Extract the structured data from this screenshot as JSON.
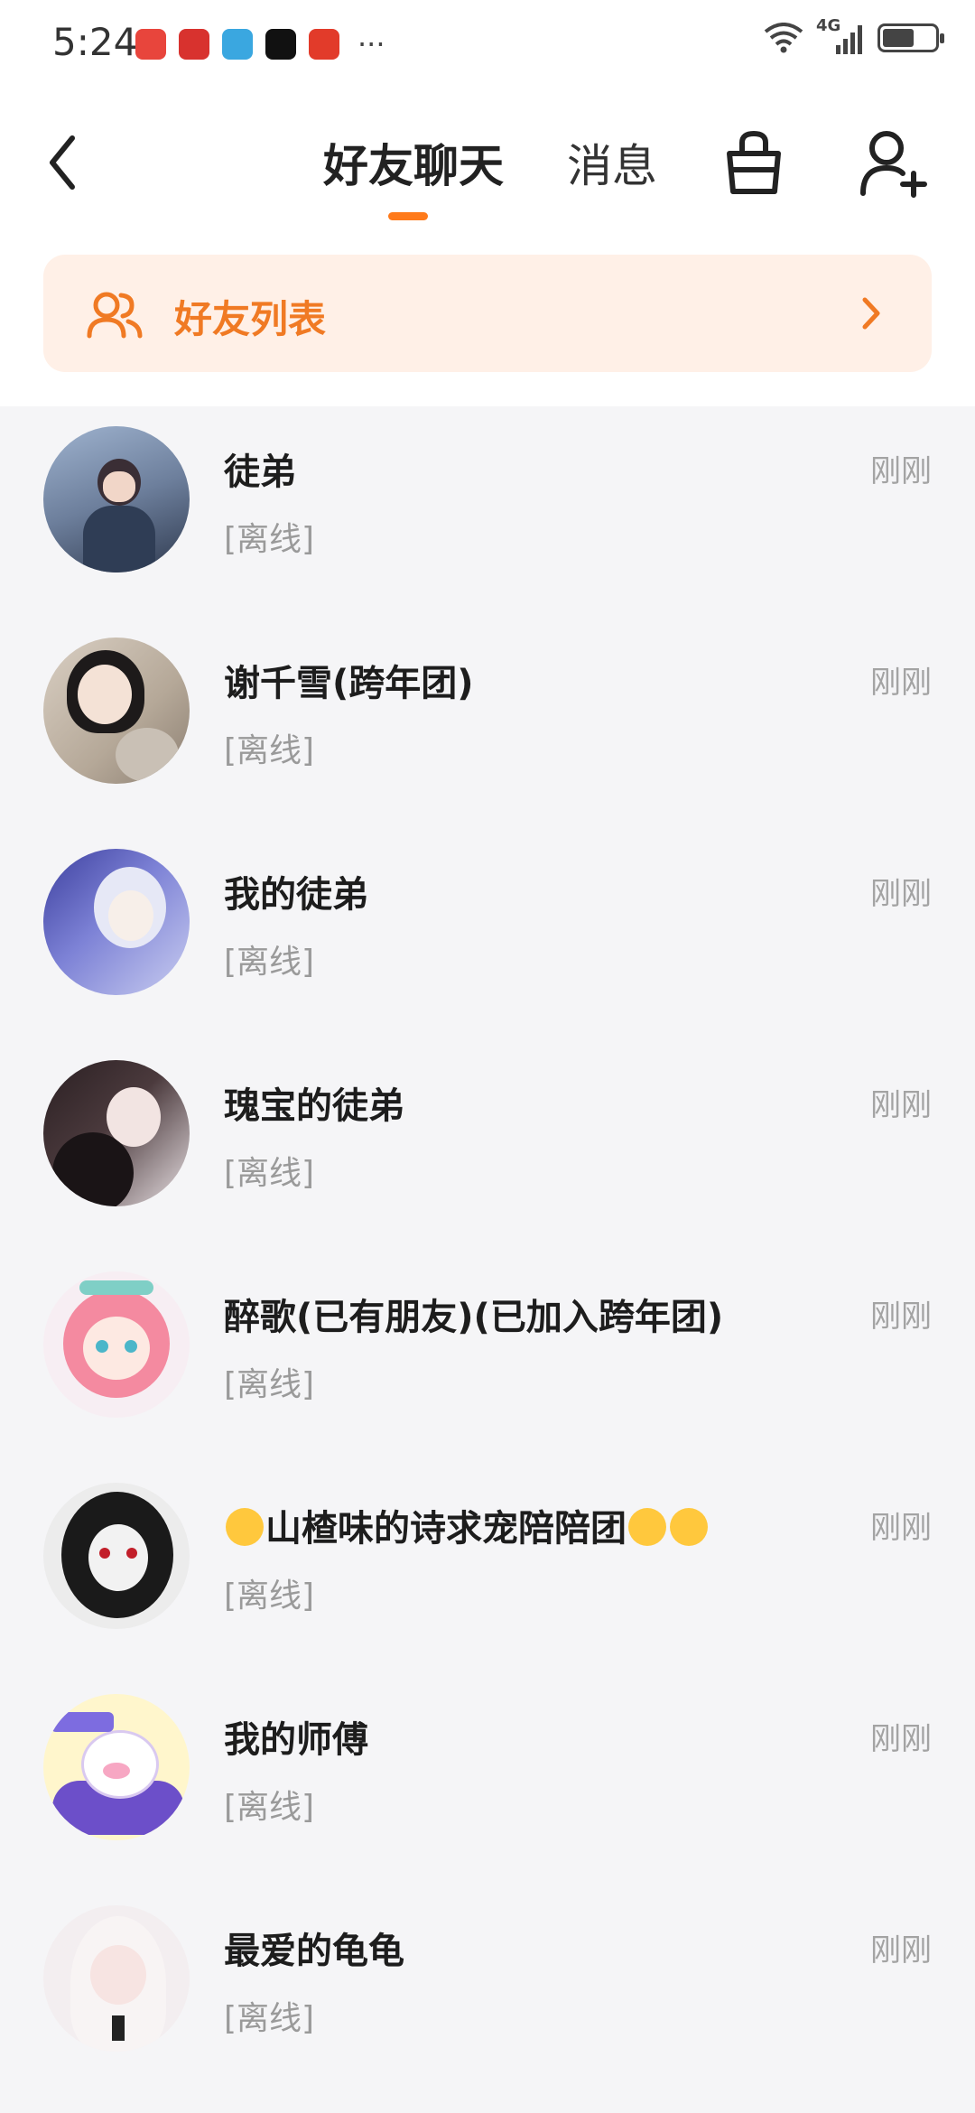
{
  "status_bar": {
    "time": "5:24",
    "more": "···",
    "network": "4G"
  },
  "header": {
    "tabs": [
      {
        "label": "好友聊天",
        "active": true
      },
      {
        "label": "消息",
        "active": false
      }
    ],
    "icons": [
      "back-arrow-icon",
      "basket-icon",
      "add-user-icon"
    ],
    "accent": "#ff7a1a"
  },
  "friend_banner": {
    "label": "好友列表",
    "color": "#f07a24",
    "bg": "#fff0e7"
  },
  "chats": [
    {
      "name": "徒弟",
      "status": "[离线]",
      "time": "刚刚"
    },
    {
      "name": "谢千雪(跨年团)",
      "status": "[离线]",
      "time": "刚刚"
    },
    {
      "name": "我的徒弟",
      "status": "[离线]",
      "time": "刚刚"
    },
    {
      "name": "瑰宝的徒弟",
      "status": "[离线]",
      "time": "刚刚"
    },
    {
      "name": "醉歌(已有朋友)(已加入跨年团)",
      "status": "[离线]",
      "time": "刚刚"
    },
    {
      "name": "山楂味的诗求宠陪陪团",
      "status": "[离线]",
      "time": "刚刚"
    },
    {
      "name": "我的师傅",
      "status": "[离线]",
      "time": "刚刚"
    },
    {
      "name": "最爱的龟龟",
      "status": "[离线]",
      "time": "刚刚"
    }
  ]
}
